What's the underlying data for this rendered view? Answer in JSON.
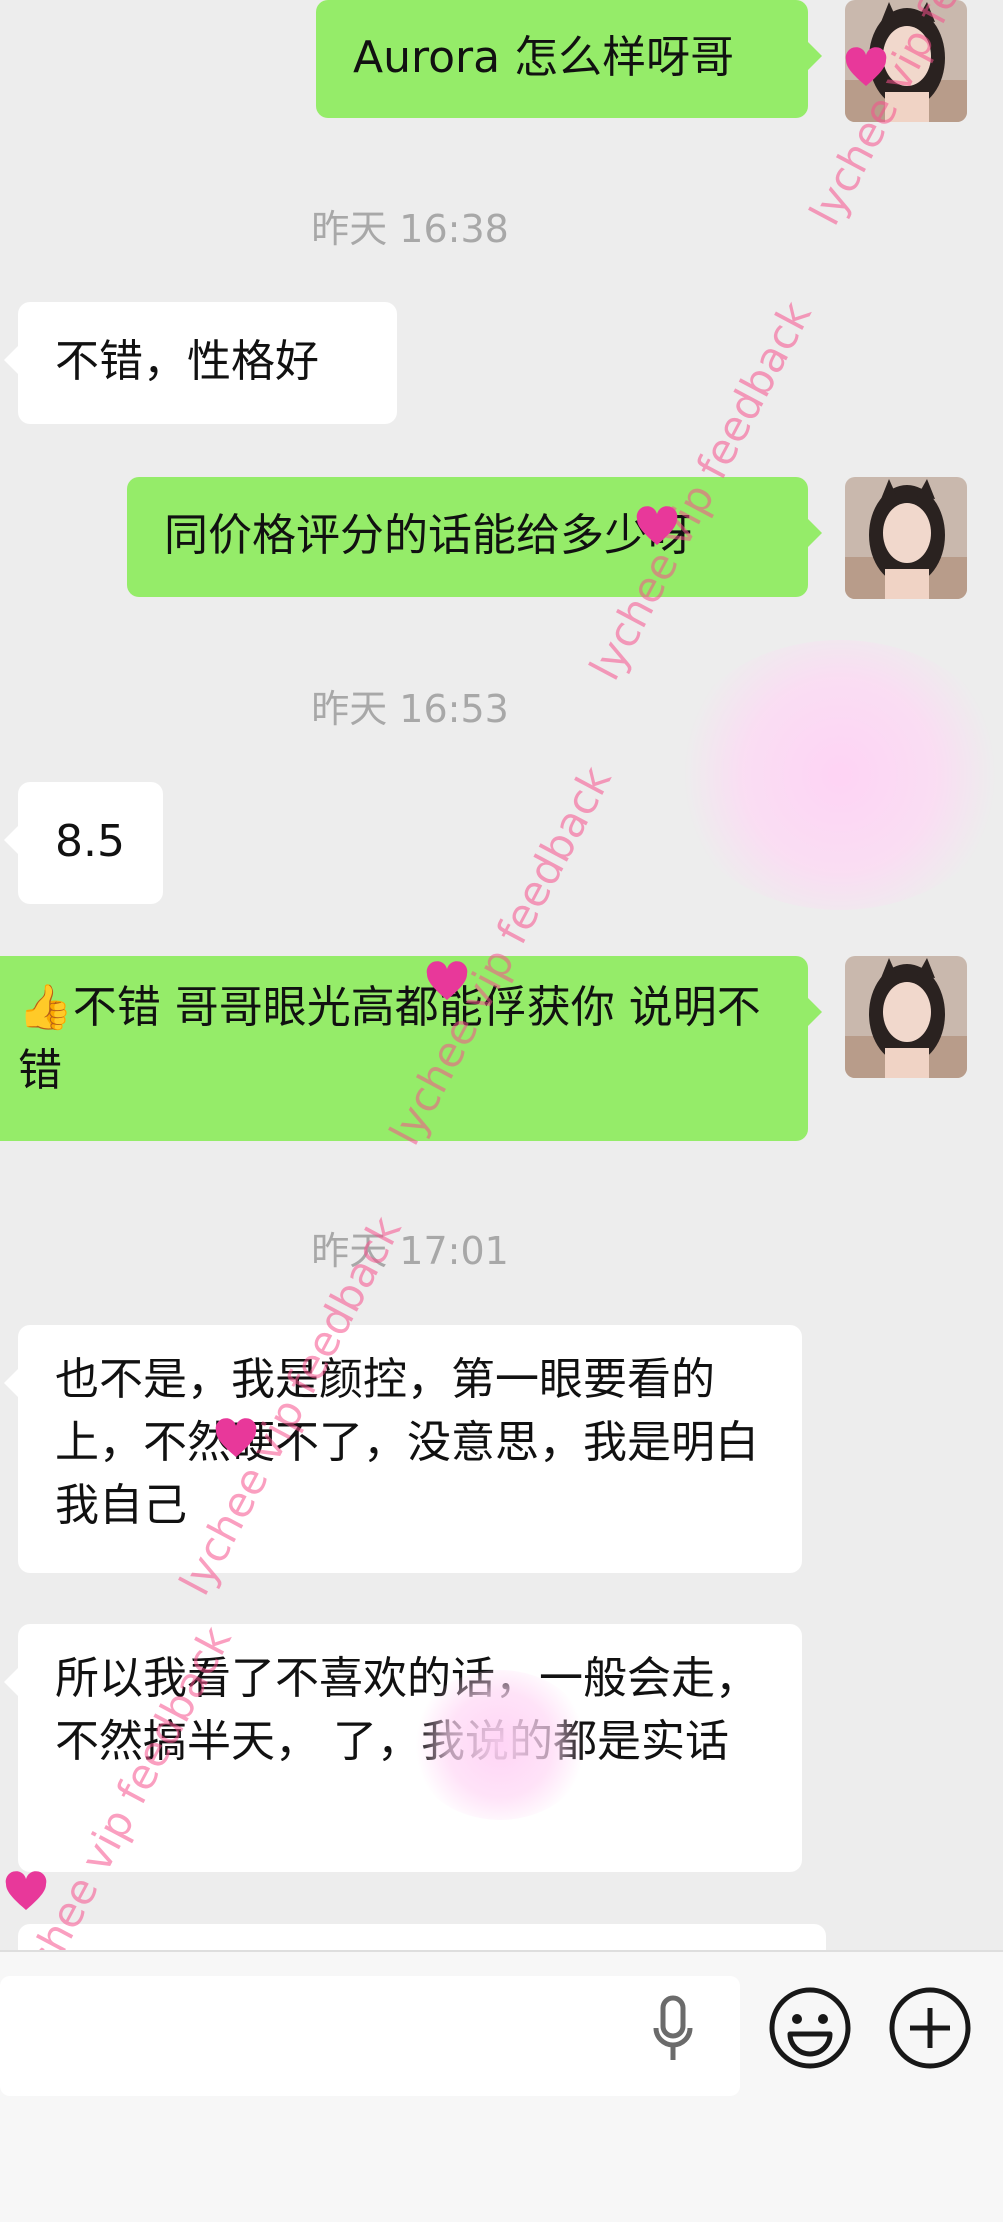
{
  "messages": [
    {
      "side": "out",
      "text": "Aurora 怎么样呀哥"
    },
    {
      "timestamp": "昨天 16:38"
    },
    {
      "side": "in",
      "text": "不错，性格好"
    },
    {
      "side": "out",
      "text": "同价格评分的话能给多少呀"
    },
    {
      "timestamp": "昨天 16:53"
    },
    {
      "side": "in",
      "text": "8.5"
    },
    {
      "side": "out",
      "text": "👍不错 哥哥眼光高都能俘获你 说明不错"
    },
    {
      "timestamp": "昨天 17:01"
    },
    {
      "side": "in",
      "text": "也不是，我是颜控，第一眼要看的上，不然硬不了，没意思，我是明白我自己"
    },
    {
      "side": "in",
      "text": "所以我看了不喜欢的话，一般会走，不然搞半天，  了，我说的都是实话"
    }
  ],
  "watermark": "lychee vip feedback",
  "input_bar": {
    "mic_icon": "microphone-icon",
    "emoji_icon": "smiley-icon",
    "plus_icon": "plus-circle-icon"
  },
  "colors": {
    "outgoing_bubble": "#95ec69",
    "incoming_bubble": "#ffffff",
    "background": "#ededed",
    "watermark": "#f5508c"
  }
}
